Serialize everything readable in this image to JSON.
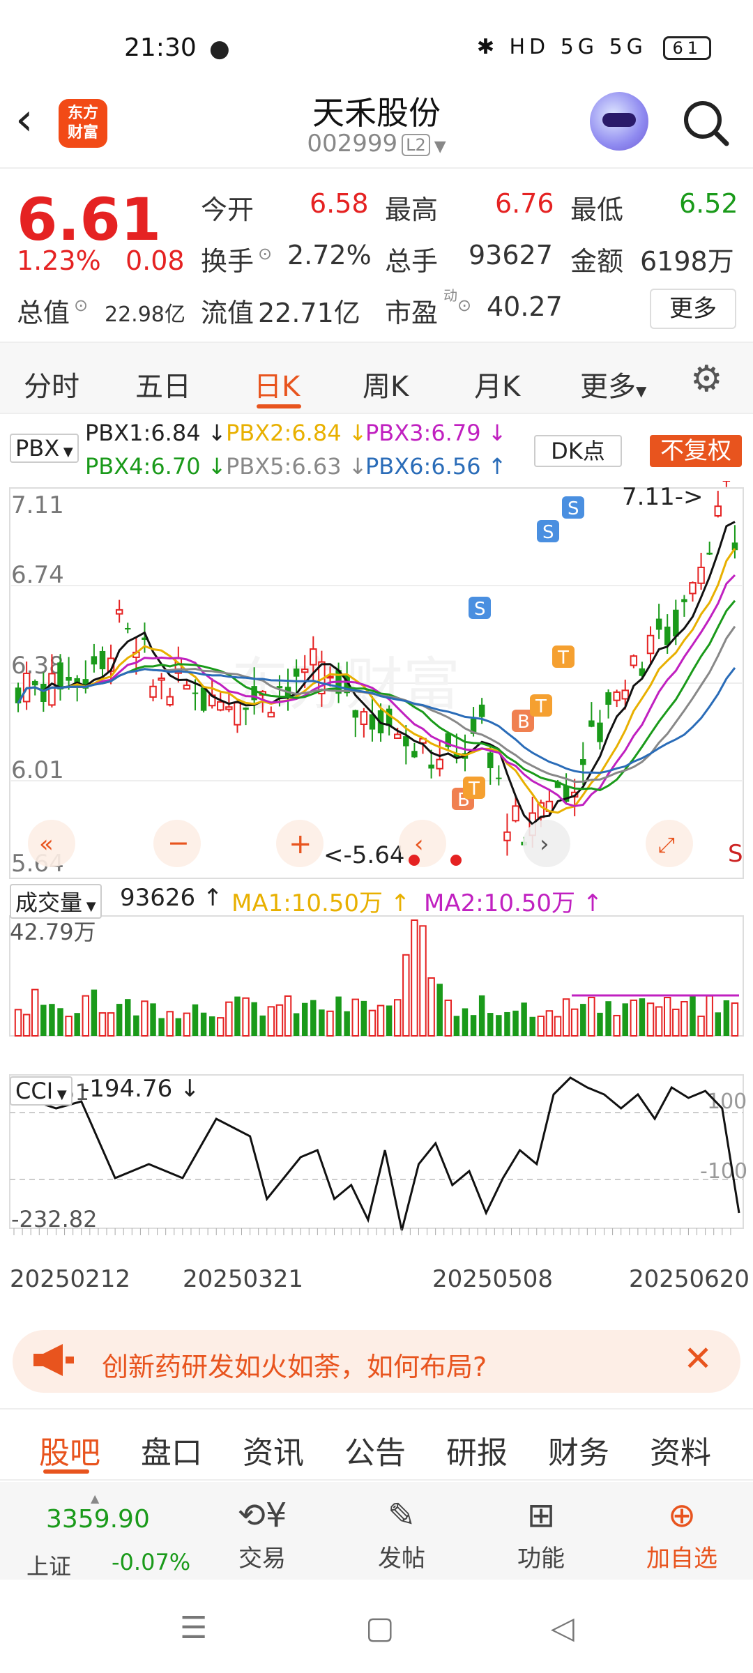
{
  "status": {
    "time": "21:30",
    "battery": "61",
    "icons": "✱ HD 5G 5G"
  },
  "header": {
    "back": "‹",
    "logo_line1": "东方",
    "logo_line2": "财富",
    "name": "天禾股份",
    "code": "002999",
    "level": "L2"
  },
  "quote": {
    "price": "6.61",
    "pct": "1.23%",
    "change": "0.08",
    "open_label": "今开",
    "open": "6.58",
    "high_label": "最高",
    "high": "6.76",
    "low_label": "最低",
    "low": "6.52",
    "turnover_label": "换手",
    "turnover": "2.72%",
    "volume_label": "总手",
    "volume": "93627",
    "amount_label": "金额",
    "amount": "6198万",
    "mktcap_label": "总值",
    "mktcap": "22.98亿",
    "float_label": "流值",
    "float": "22.71亿",
    "pe_label": "市盈",
    "pe_sup": "动",
    "pe": "40.27",
    "more": "更多"
  },
  "tabs": [
    "分时",
    "五日",
    "日K",
    "周K",
    "月K",
    "更多"
  ],
  "active_tab": "日K",
  "indicator": {
    "name": "PBX",
    "pbx1": "PBX1:6.84",
    "pbx1_arrow": "↓",
    "pbx2": "PBX2:6.84",
    "pbx2_arrow": "↓",
    "pbx3": "PBX3:6.79",
    "pbx3_arrow": "↓",
    "pbx4": "PBX4:6.70",
    "pbx4_arrow": "↓",
    "pbx5": "PBX5:6.63",
    "pbx5_arrow": "↓",
    "pbx6": "PBX6:6.56",
    "pbx6_arrow": "↑",
    "dk": "DK点",
    "fq": "不复权"
  },
  "kline": {
    "yticks": [
      "7.11",
      "6.74",
      "6.38",
      "6.01",
      "5.64"
    ],
    "high_mark": "7.11->",
    "low_mark": "<-5.64",
    "signals": [
      "S",
      "S",
      "S",
      "B",
      "B",
      "T",
      "T",
      "T"
    ],
    "watermark": "东方财富",
    "right_label": "S"
  },
  "volume": {
    "name": "成交量",
    "value": "93626",
    "arrow": "↑",
    "ma1": "MA1:10.50万",
    "ma1_arrow": "↑",
    "ma2": "MA2:10.50万",
    "ma2_arrow": "↑",
    "max": "42.79万"
  },
  "cci": {
    "name": "CCI",
    "value": "-194.76",
    "arrow": "↓",
    "top": "180.51",
    "bottom": "-232.82",
    "line100": "100",
    "line_neg100": "-100"
  },
  "dates": [
    "20250212",
    "20250321",
    "20250508",
    "20250620"
  ],
  "banner": {
    "text": "创新药研发如火如荼，如何布局?",
    "close": "✕"
  },
  "bottom_tabs": [
    "股吧",
    "盘口",
    "资讯",
    "公告",
    "研报",
    "财务",
    "资料"
  ],
  "toolbar": {
    "index_value": "3359.90",
    "index_name": "上证",
    "index_change": "-0.07%",
    "trade": "交易",
    "post": "发帖",
    "func": "功能",
    "add": "加自选"
  },
  "colors": {
    "up": "#e52222",
    "down": "#1a9a1a",
    "accent": "#e8541e"
  }
}
